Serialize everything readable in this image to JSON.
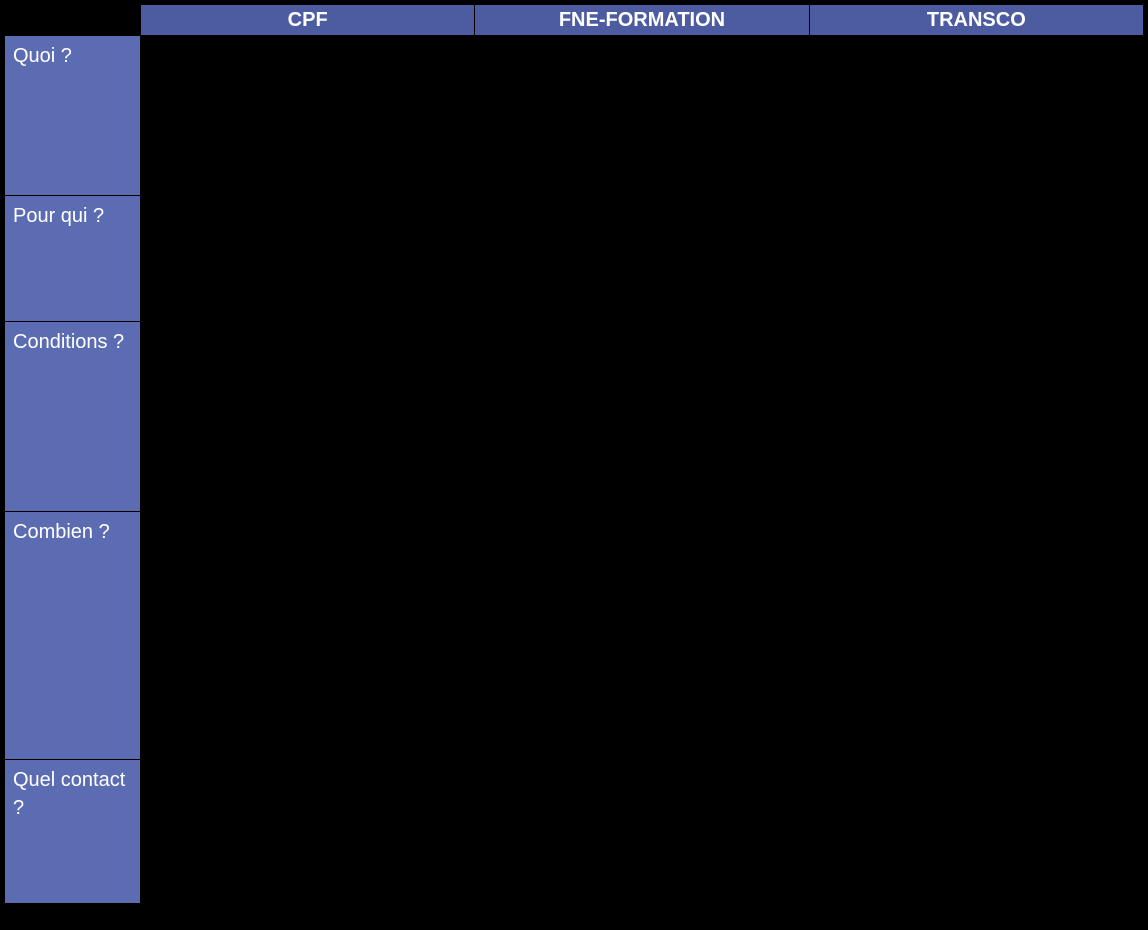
{
  "columns": {
    "cpf": "CPF",
    "fne": "FNE-FORMATION",
    "transco": "TRANSCO"
  },
  "rows": {
    "quoi": "Quoi ?",
    "pourqui": "Pour qui ?",
    "conditions": "Conditions ?",
    "combien": "Combien ?",
    "contact": "Quel contact ?"
  }
}
